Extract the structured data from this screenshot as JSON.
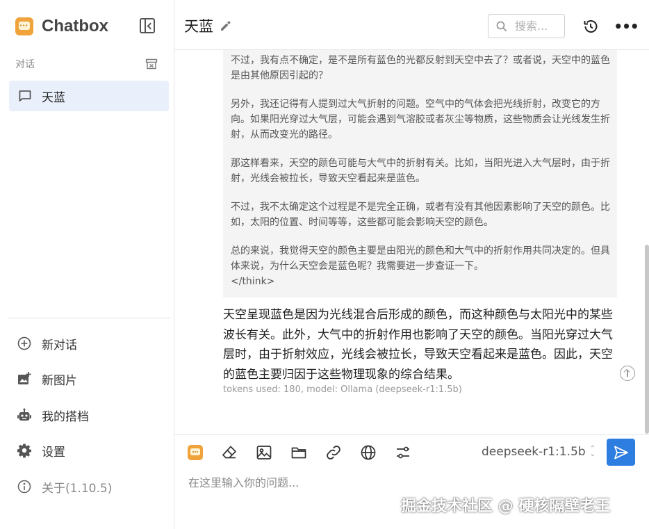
{
  "app": {
    "name": "Chatbox"
  },
  "sidebar": {
    "section_label": "对话",
    "conversations": [
      {
        "label": "天蓝",
        "icon": "chat-bubble-icon"
      }
    ],
    "menu": [
      {
        "label": "新对话",
        "icon": "plus-circle-icon"
      },
      {
        "label": "新图片",
        "icon": "image-add-icon"
      },
      {
        "label": "我的搭档",
        "icon": "robot-icon"
      },
      {
        "label": "设置",
        "icon": "gear-icon"
      },
      {
        "label": "关于(1.10.5)",
        "icon": "info-icon"
      }
    ]
  },
  "header": {
    "title": "天蓝",
    "search_placeholder": "搜索..."
  },
  "messages": {
    "think_paragraphs": [
      "不过，我有点不确定，是不是所有蓝色的光都反射到天空中去了？或者说，天空中的蓝色是由其他原因引起的？",
      "另外，我还记得有人提到过大气折射的问题。空气中的气体会把光线折射，改变它的方向。如果阳光穿过大气层，可能会遇到气溶胶或者灰尘等物质，这些物质会让光线发生折射，从而改变光的路径。",
      "那这样看来，天空的颜色可能与大气中的折射有关。比如，当阳光进入大气层时，由于折射，光线会被拉长，导致天空看起来是蓝色。",
      "不过，我不太确定这个过程是不是完全正确，或者有没有其他因素影响了天空的颜色。比如，太阳的位置、时间等等，这些都可能会影响天空的颜色。",
      "总的来说，我觉得天空的颜色主要是由阳光的颜色和大气中的折射作用共同决定的。但具体来说，为什么天空会是蓝色呢？我需要进一步查证一下。"
    ],
    "think_end_tag": "</think>",
    "answer": "天空呈现蓝色是因为光线混合后形成的颜色，而这种颜色与太阳光中的某些波长有关。此外，大气中的折射作用也影响了天空的颜色。当阳光穿过大气层时，由于折射效应，光线会被拉长，导致天空看起来是蓝色。因此，天空的蓝色主要归因于这些物理现象的综合结果。",
    "meta": "tokens used: 180, model: Ollama (deepseek-r1:1.5b)"
  },
  "composer": {
    "model": "deepseek-r1:1.5b",
    "placeholder": "在这里输入你的问题...",
    "tools": [
      "chatbox-logo-icon",
      "eraser-icon",
      "image-icon",
      "folder-icon",
      "link-icon",
      "globe-icon",
      "sliders-icon"
    ]
  },
  "watermark": "掘金技术社区 @ 硬核隔壁老王",
  "colors": {
    "accent": "#2e7de1",
    "selected_bg": "#e9f0fb",
    "think_bg": "#f4f4f4"
  }
}
